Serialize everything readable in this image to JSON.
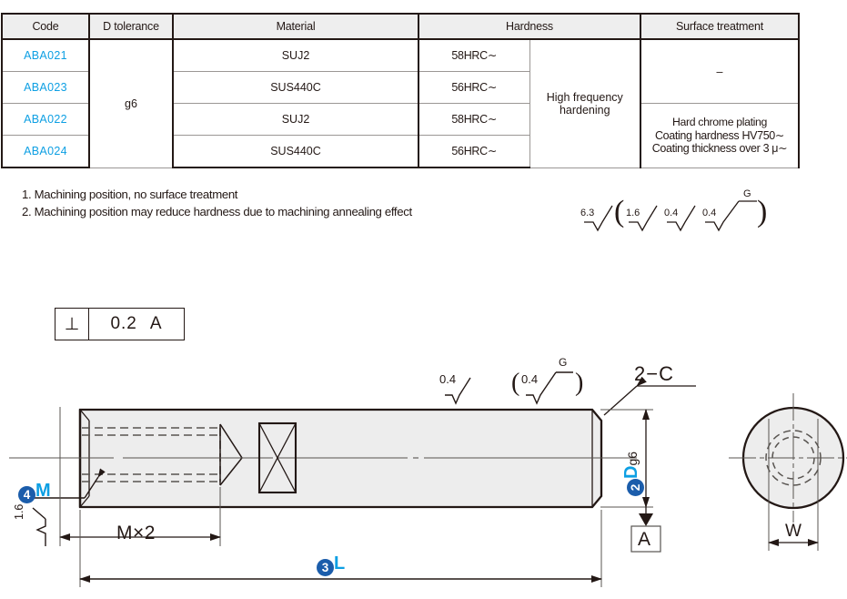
{
  "table": {
    "headers": [
      "Code",
      "D tolerance",
      "Material",
      "Hardness",
      "Surface treatment"
    ],
    "rows": [
      {
        "code": "ABA021",
        "d_tolerance": "g6",
        "material": "SUJ2",
        "hardness": "58HRC∼",
        "hardening": "High frequency hardening",
        "surface": "–"
      },
      {
        "code": "ABA023",
        "d_tolerance": "g6",
        "material": "SUS440C",
        "hardness": "56HRC∼",
        "hardening": "High frequency hardening",
        "surface": "–"
      },
      {
        "code": "ABA022",
        "d_tolerance": "g6",
        "material": "SUJ2",
        "hardness": "58HRC∼",
        "hardening": "High frequency hardening",
        "surface": "Hard chrome plating"
      },
      {
        "code": "ABA024",
        "d_tolerance": "g6",
        "material": "SUS440C",
        "hardness": "56HRC∼",
        "hardening": "High frequency hardening",
        "surface": "Hard chrome plating"
      }
    ],
    "merged": {
      "d_tolerance": "g6",
      "hardening": "High frequency",
      "hardening_line2": "hardening",
      "surface_top": "–",
      "surface_bottom_l1": "Hard chrome plating",
      "surface_bottom_l2": "Coating hardness HV750∼",
      "surface_bottom_l3": "Coating thickness over 3 μ∼"
    }
  },
  "notes": {
    "note1": "1. Machining position, no surface treatment",
    "note2": "2. Machining position may reduce hardness due to machining annealing effect"
  },
  "roughness_note": {
    "primary": "6.3",
    "open_paren": "(",
    "v1": "1.6",
    "v2": "0.4",
    "v3": "0.4",
    "v3_sup": "G",
    "close_paren": ")"
  },
  "gdt": {
    "symbol": "⊥",
    "tolerance": "0.2",
    "datum": "A"
  },
  "drawing": {
    "rough_top_left": "0.4",
    "rough_top_right": "0.4",
    "rough_top_right_sup": "G",
    "rough_paren_open": "(",
    "rough_paren_close": ")",
    "chamfer": "2−C",
    "thread_badge": "4",
    "thread_label": "M",
    "thread_depth": "M×2",
    "rough_bottom_left": "1.6",
    "diameter_badge": "2",
    "diameter_label": "D",
    "diameter_tol": "g6",
    "datum_box": "A",
    "length_badge": "3",
    "length_label": "L",
    "width_label": "W"
  },
  "colors": {
    "code_blue": "#0d9fe3",
    "badge_blue": "#1b5dab",
    "line": "#231815",
    "body_fill": "#eeeeee",
    "grid": "#9b9795"
  }
}
